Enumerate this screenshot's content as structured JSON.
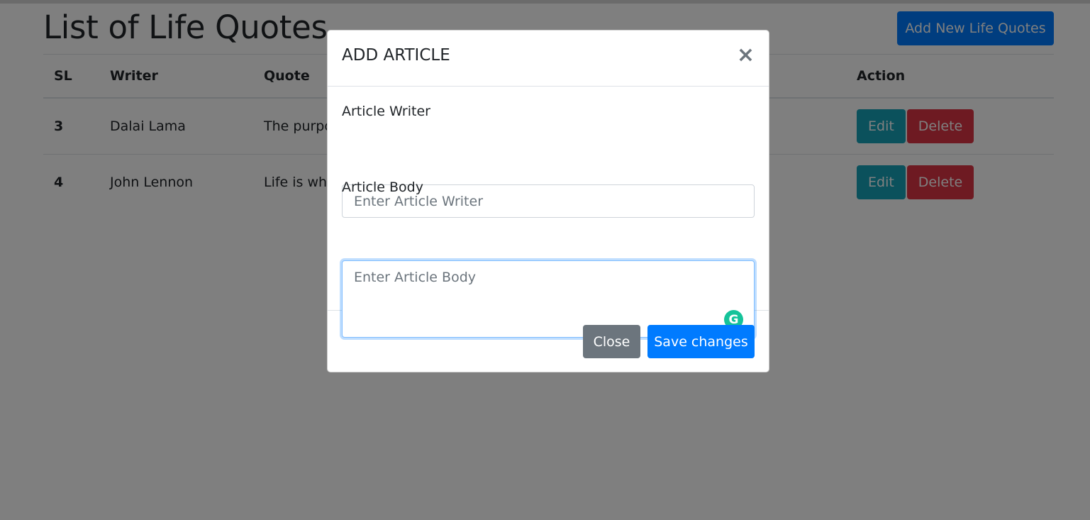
{
  "page": {
    "title": "List of Life Quotes",
    "add_button": "Add New Life Quotes"
  },
  "table": {
    "headers": {
      "sl": "SL",
      "writer": "Writer",
      "quote": "Quote",
      "action": "Action"
    },
    "rows": [
      {
        "sl": "3",
        "writer": "Dalai Lama",
        "quote": "The purpo",
        "edit": "Edit",
        "delete": "Delete"
      },
      {
        "sl": "4",
        "writer": "John Lennon",
        "quote": "Life is wha",
        "edit": "Edit",
        "delete": "Delete"
      }
    ]
  },
  "modal": {
    "title": "ADD ARTICLE",
    "close_symbol": "×",
    "writer_label": "Article Writer",
    "writer_placeholder": "Enter Article Writer",
    "writer_value": "",
    "body_label": "Article Body",
    "body_placeholder": "Enter Article Body",
    "body_value": "",
    "grammarly_glyph": "G",
    "close_button": "Close",
    "save_button": "Save changes"
  },
  "colors": {
    "primary": "#007bff",
    "secondary": "#6c757d",
    "info": "#17a2b8",
    "danger": "#dc3545",
    "grammarly": "#15c39a"
  },
  "icons": [
    "close-icon",
    "grammarly-icon",
    "resize-handle-icon"
  ]
}
